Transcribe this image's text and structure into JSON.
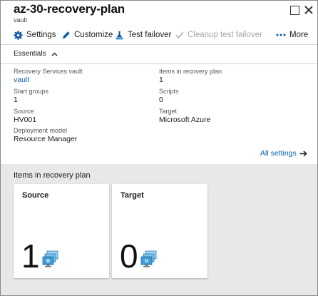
{
  "header": {
    "title": "az-30-recovery-plan",
    "subtitle": "vault"
  },
  "toolbar": {
    "settings": "Settings",
    "customize": "Customize",
    "test_failover": "Test failover",
    "cleanup_test_failover": "Cleanup test failover",
    "more": "More"
  },
  "essentials": {
    "label": "Essentials"
  },
  "properties": {
    "recovery_services_vault": {
      "label": "Recovery Services vault",
      "value": "vault"
    },
    "start_groups": {
      "label": "Start groups",
      "value": "1"
    },
    "source": {
      "label": "Source",
      "value": "HV001"
    },
    "deployment_model": {
      "label": "Deployment model",
      "value": "Resource Manager"
    },
    "items_in_recovery_plan": {
      "label": "Items in recovery plan",
      "value": "1"
    },
    "scripts": {
      "label": "Scripts",
      "value": "0"
    },
    "target": {
      "label": "Target",
      "value": "Microsoft Azure"
    }
  },
  "all_settings": "All settings",
  "items_section": {
    "title": "Items in recovery plan",
    "tiles": [
      {
        "title": "Source",
        "count": "1",
        "icon": "virtual-machines-icon"
      },
      {
        "title": "Target",
        "count": "0",
        "icon": "virtual-machines-icon"
      }
    ]
  },
  "colors": {
    "link": "#0062ad",
    "panel_gray": "#e8e8e8",
    "vm_icon": "#3f9ad6",
    "disabled": "#a6a6a6"
  }
}
